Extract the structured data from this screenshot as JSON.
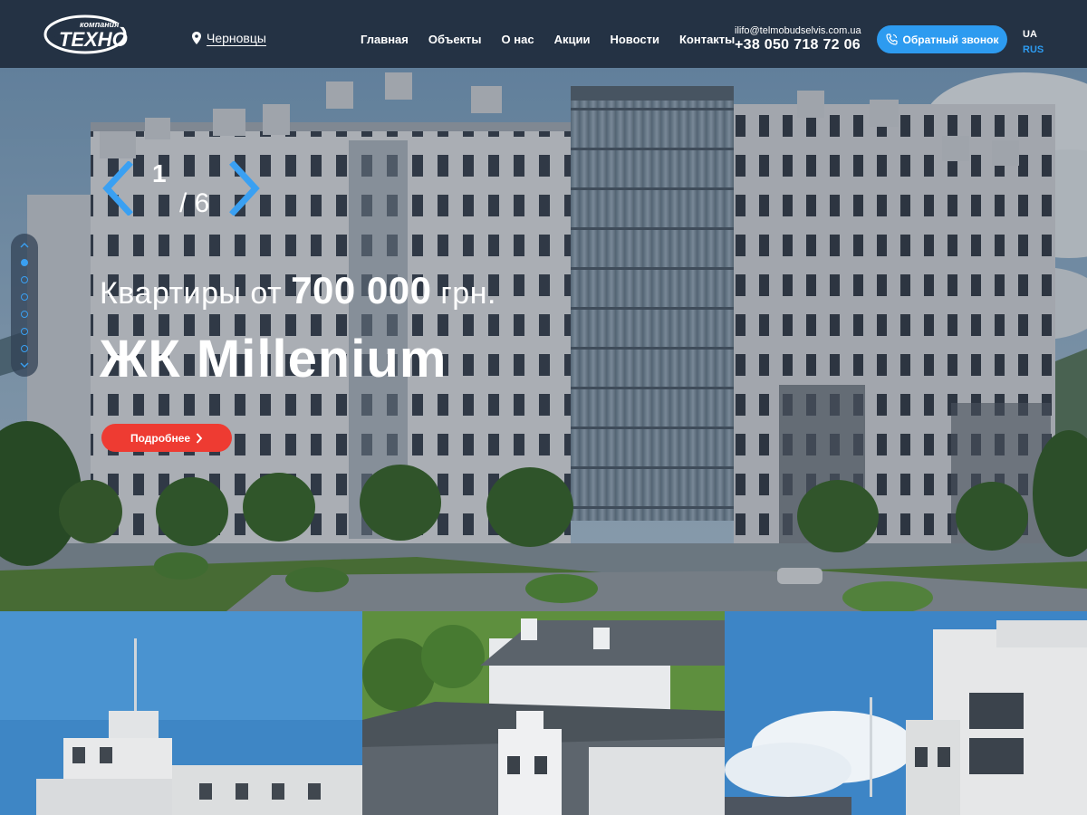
{
  "header": {
    "logo_text": "компания ТЕХНО",
    "city": "Черновцы",
    "nav": [
      "Главная",
      "Объекты",
      "О нас",
      "Акции",
      "Новости",
      "Контакты"
    ],
    "email": "ilifo@telmobudselvis.com.ua",
    "phone": "+38 050 718 72 06",
    "callback_label": "Обратный звонок",
    "lang_ua": "UA",
    "lang_rus": "RUS"
  },
  "hero": {
    "slide_current": "1",
    "slide_total": "/ 6",
    "subtitle_prefix": "Квартиры от ",
    "price": "700 000",
    "subtitle_suffix": " грн.",
    "title": "ЖК Millenium",
    "more_label": "Подробнее",
    "active_dot": 1,
    "dot_count": 6
  },
  "colors": {
    "header_bg": "#243244",
    "accent_blue": "#2d9bf0",
    "accent_red": "#ee3b32"
  }
}
